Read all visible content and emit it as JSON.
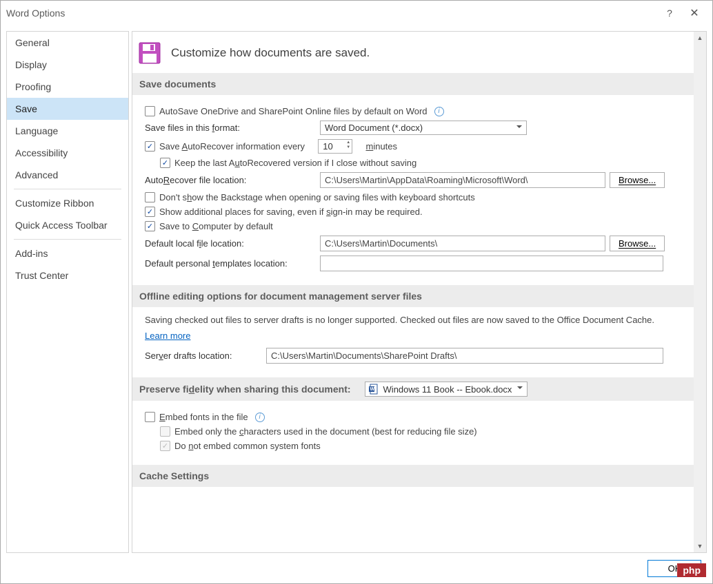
{
  "window": {
    "title": "Word Options"
  },
  "sidebar": {
    "items": [
      "General",
      "Display",
      "Proofing",
      "Save",
      "Language",
      "Accessibility",
      "Advanced"
    ],
    "items2": [
      "Customize Ribbon",
      "Quick Access Toolbar"
    ],
    "items3": [
      "Add-ins",
      "Trust Center"
    ],
    "selected": "Save"
  },
  "header": {
    "subtitle": "Customize how documents are saved."
  },
  "save_docs": {
    "heading": "Save documents",
    "autosave_label": "AutoSave OneDrive and SharePoint Online files by default on Word",
    "autosave_checked": false,
    "format_label": "Save files in this format:",
    "format_value": "Word Document (*.docx)",
    "autorecover": {
      "checked": true,
      "label_pre": "Save AutoRecover information every",
      "value": "10",
      "unit": "minutes"
    },
    "keep_last": {
      "checked": true,
      "label": "Keep the last AutoRecovered version if I close without saving"
    },
    "autorecover_loc": {
      "label": "AutoRecover file location:",
      "value": "C:\\Users\\Martin\\AppData\\Roaming\\Microsoft\\Word\\",
      "browse": "Browse..."
    },
    "dont_show_backstage": {
      "checked": false,
      "label": "Don't show the Backstage when opening or saving files with keyboard shortcuts"
    },
    "show_additional": {
      "checked": true,
      "label": "Show additional places for saving, even if sign-in may be required."
    },
    "save_to_computer": {
      "checked": true,
      "label": "Save to Computer by default"
    },
    "default_local": {
      "label": "Default local file location:",
      "value": "C:\\Users\\Martin\\Documents\\",
      "browse": "Browse..."
    },
    "default_templates": {
      "label": "Default personal templates location:",
      "value": ""
    }
  },
  "offline": {
    "heading": "Offline editing options for document management server files",
    "note": "Saving checked out files to server drafts is no longer supported. Checked out files are now saved to the Office Document Cache.",
    "learn_more": "Learn more",
    "server_drafts": {
      "label": "Server drafts location:",
      "value": "C:\\Users\\Martin\\Documents\\SharePoint Drafts\\"
    }
  },
  "preserve": {
    "heading": "Preserve fidelity when sharing this document:",
    "doc_value": "Windows 11 Book -- Ebook.docx",
    "embed_fonts": {
      "checked": false,
      "label": "Embed fonts in the file"
    },
    "embed_only": {
      "checked": false,
      "label": "Embed only the characters used in the document (best for reducing file size)"
    },
    "do_not_embed": {
      "checked": true,
      "label": "Do not embed common system fonts"
    }
  },
  "cache": {
    "heading": "Cache Settings"
  },
  "footer": {
    "ok": "OK"
  },
  "watermark": "php"
}
